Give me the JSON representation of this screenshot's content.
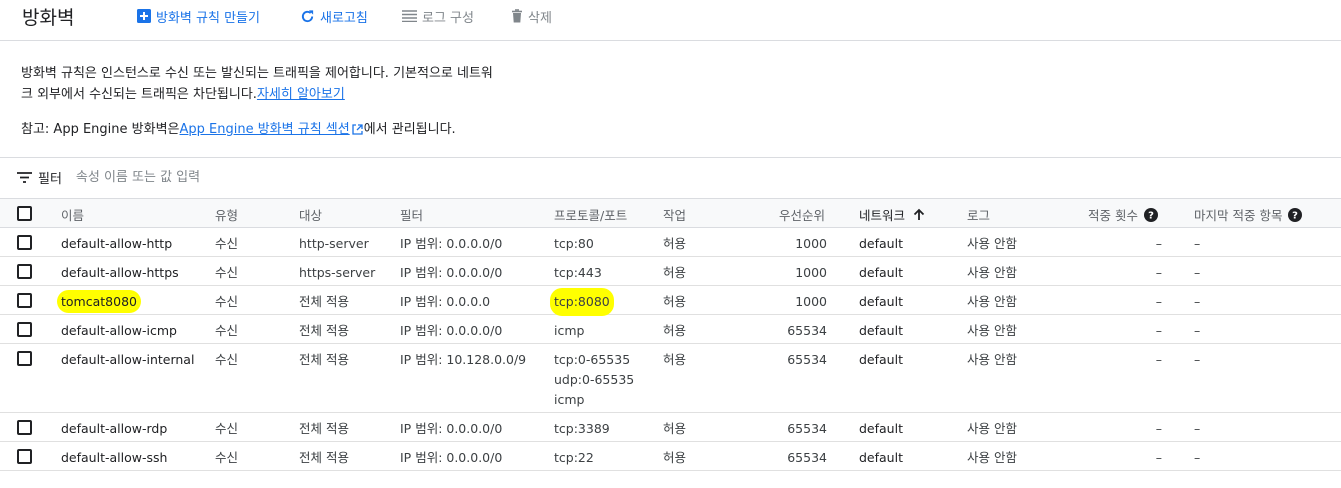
{
  "header": {
    "title": "방화벽",
    "create_label": "방화벽 규칙 만들기",
    "refresh_label": "새로고침",
    "logs_label": "로그 구성",
    "delete_label": "삭제"
  },
  "description": {
    "text_line1": "방화벽 규칙은 인스턴스로 수신 또는 발신되는 트래픽을 제어합니다. 기본적으로 네트워",
    "text_line2": "크 외부에서 수신되는 트래픽은 차단됩니다.",
    "learn_more": "자세히 알아보기",
    "note_prefix": "참고: App Engine 방화벽은 ",
    "note_link": "App Engine 방화벽 규칙 섹션",
    "note_suffix": "에서 관리됩니다."
  },
  "filter": {
    "label": "필터",
    "placeholder": "속성 이름 또는 값 입력"
  },
  "table": {
    "columns": {
      "name": "이름",
      "type": "유형",
      "target": "대상",
      "filter": "필터",
      "protocol": "프로토콜/포트",
      "action": "작업",
      "priority": "우선순위",
      "network": "네트워크",
      "logs": "로그",
      "hit_count": "적중 횟수",
      "last_hit": "마지막 적중 항목"
    },
    "rows": [
      {
        "name": "default-allow-http",
        "type": "수신",
        "target": "http-server",
        "filter": "IP 범위: 0.0.0.0/0",
        "protocol": [
          "tcp:80"
        ],
        "action": "허용",
        "priority": "1000",
        "network": "default",
        "logs": "사용 안함",
        "hit_count": "–",
        "last_hit": "–"
      },
      {
        "name": "default-allow-https",
        "type": "수신",
        "target": "https-server",
        "filter": "IP 범위: 0.0.0.0/0",
        "protocol": [
          "tcp:443"
        ],
        "action": "허용",
        "priority": "1000",
        "network": "default",
        "logs": "사용 안함",
        "hit_count": "–",
        "last_hit": "–"
      },
      {
        "name": "tomcat8080",
        "type": "수신",
        "target": "전체 적용",
        "filter": "IP 범위: 0.0.0.0",
        "protocol": [
          "tcp:8080"
        ],
        "action": "허용",
        "priority": "1000",
        "network": "default",
        "logs": "사용 안함",
        "hit_count": "–",
        "last_hit": "–"
      },
      {
        "name": "default-allow-icmp",
        "type": "수신",
        "target": "전체 적용",
        "filter": "IP 범위: 0.0.0.0/0",
        "protocol": [
          "icmp"
        ],
        "action": "허용",
        "priority": "65534",
        "network": "default",
        "logs": "사용 안함",
        "hit_count": "–",
        "last_hit": "–"
      },
      {
        "name": "default-allow-internal",
        "type": "수신",
        "target": "전체 적용",
        "filter": "IP 범위: 10.128.0.0/9",
        "protocol": [
          "tcp:0-65535",
          "udp:0-65535",
          "icmp"
        ],
        "action": "허용",
        "priority": "65534",
        "network": "default",
        "logs": "사용 안함",
        "hit_count": "–",
        "last_hit": "–"
      },
      {
        "name": "default-allow-rdp",
        "type": "수신",
        "target": "전체 적용",
        "filter": "IP 범위: 0.0.0.0/0",
        "protocol": [
          "tcp:3389"
        ],
        "action": "허용",
        "priority": "65534",
        "network": "default",
        "logs": "사용 안함",
        "hit_count": "–",
        "last_hit": "–"
      },
      {
        "name": "default-allow-ssh",
        "type": "수신",
        "target": "전체 적용",
        "filter": "IP 범위: 0.0.0.0/0",
        "protocol": [
          "tcp:22"
        ],
        "action": "허용",
        "priority": "65534",
        "network": "default",
        "logs": "사용 안함",
        "hit_count": "–",
        "last_hit": "–"
      }
    ]
  },
  "colors": {
    "accent": "#1a73e8",
    "highlight": "#ffff00"
  }
}
